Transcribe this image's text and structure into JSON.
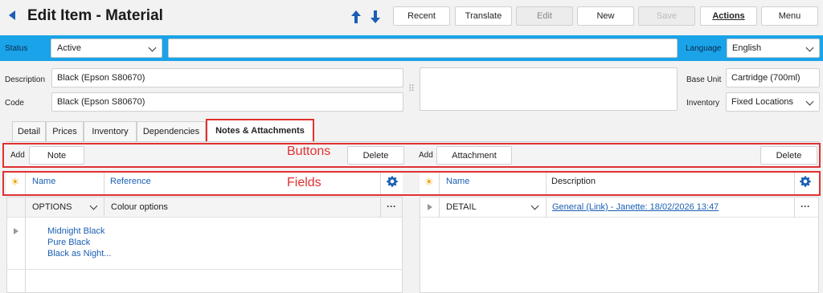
{
  "header": {
    "title": "Edit Item - Material",
    "buttons": {
      "recent": "Recent",
      "translate": "Translate",
      "edit": "Edit",
      "new": "New",
      "save": "Save",
      "actions": "Actions",
      "menu": "Menu"
    }
  },
  "statusbar": {
    "status_label": "Status",
    "status_value": "Active",
    "status_text": "",
    "language_label": "Language",
    "language_value": "English"
  },
  "fields": {
    "description_label": "Description",
    "description_value": "Black (Epson S80670)",
    "code_label": "Code",
    "code_value": "Black (Epson S80670)",
    "base_unit_label": "Base Unit",
    "base_unit_value": "Cartridge (700ml)",
    "inventory_label": "Inventory",
    "inventory_value": "Fixed Locations"
  },
  "tabs": [
    {
      "label": "Detail"
    },
    {
      "label": "Prices"
    },
    {
      "label": "Inventory"
    },
    {
      "label": "Dependencies"
    },
    {
      "label": "Notes & Attachments",
      "active": true
    }
  ],
  "annotations": {
    "buttons": "Buttons",
    "fields": "Fields"
  },
  "notes_panel": {
    "add_label": "Add",
    "note_button": "Note",
    "delete_button": "Delete",
    "columns": {
      "name": "Name",
      "reference": "Reference"
    },
    "rows": [
      {
        "name": "OPTIONS",
        "reference": "Colour options"
      }
    ],
    "options_list": [
      "Midnight Black",
      "Pure Black",
      "Black as Night..."
    ]
  },
  "attachments_panel": {
    "add_label": "Add",
    "attachment_button": "Attachment",
    "delete_button": "Delete",
    "columns": {
      "name": "Name",
      "description": "Description"
    },
    "rows": [
      {
        "name": "DETAIL",
        "description": "General (Link) - Janette: 18/02/2026 13:47"
      }
    ]
  },
  "colors": {
    "accent_blue": "#1aa3e8",
    "link_blue": "#1a5fb4",
    "annotation_red": "#e03131"
  },
  "icons": [
    "back-arrow-icon",
    "arrow-up-icon",
    "arrow-down-icon",
    "chevron-down-icon",
    "sun-icon",
    "gear-icon",
    "more-dots-icon",
    "expand-triangle-icon",
    "grip-icon"
  ]
}
